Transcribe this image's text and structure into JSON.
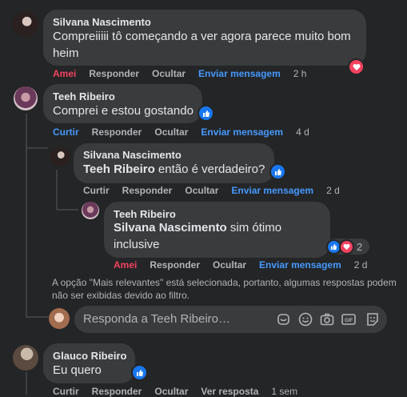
{
  "comments": {
    "c1": {
      "author": "Silvana Nascimento",
      "text_line1": "Compreiiiii tô começando a ver agora parece muito bom",
      "text_line2": "heim",
      "actions": [
        "Amei",
        "Responder",
        "Ocultar",
        "Enviar mensagem"
      ],
      "time": "2 h",
      "reaction": "love"
    },
    "c2": {
      "author": "Teeh Ribeiro",
      "text": "Comprei e estou gostando",
      "actions": [
        "Curtir",
        "Responder",
        "Ocultar",
        "Enviar mensagem"
      ],
      "time": "4 d",
      "reaction": "like"
    },
    "r1": {
      "author": "Silvana Nascimento",
      "mention": "Teeh Ribeiro",
      "text": "então é verdadeiro?",
      "actions": [
        "Curtir",
        "Responder",
        "Ocultar",
        "Enviar mensagem"
      ],
      "time": "2 d",
      "reaction": "like"
    },
    "r2": {
      "author": "Teeh Ribeiro",
      "mention": "Silvana Nascimento",
      "text_line1": "sim ótimo",
      "text_line2": "inclusive",
      "actions": [
        "Amei",
        "Responder",
        "Ocultar",
        "Enviar mensagem"
      ],
      "time": "2 d",
      "reaction_count": "2"
    },
    "c3": {
      "author": "Glauco Ribeiro",
      "text": "Eu quero",
      "actions": [
        "Curtir",
        "Responder",
        "Ocultar",
        "Ver resposta"
      ],
      "time": "1 sem",
      "reaction": "like"
    }
  },
  "notice_line1": "A opção \"Mais relevantes\" está selecionada, portanto, algumas respostas podem",
  "notice_line2": "não ser exibidas devido ao filtro.",
  "reply_input": {
    "placeholder": "Responda a Teeh Ribeiro…",
    "tools": [
      "sticker-icon",
      "emoji-icon",
      "camera-icon",
      "gif-icon",
      "avatar-sticker-icon"
    ]
  },
  "colors": {
    "background": "#242526",
    "bubble": "#3a3b3c",
    "link_blue": "#4599ff",
    "love_red": "#f3425f",
    "like_blue": "#1877f2"
  }
}
